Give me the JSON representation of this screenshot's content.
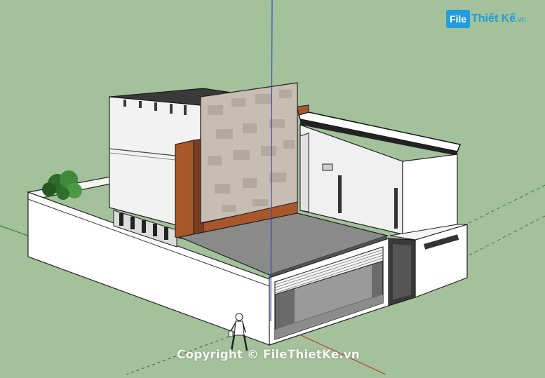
{
  "scene": {
    "subject": "sketchup-3d-house-model",
    "background_color": "#a3c19a",
    "axis_colors": {
      "blue": "#3344cc",
      "red": "#c04040",
      "green": "#2e8b3a"
    }
  },
  "logo": {
    "mark": "File",
    "brand": "Thiết Kế",
    "suffix": ".vn"
  },
  "watermark": {
    "text": "Copyright © FileThietKe.vn"
  }
}
